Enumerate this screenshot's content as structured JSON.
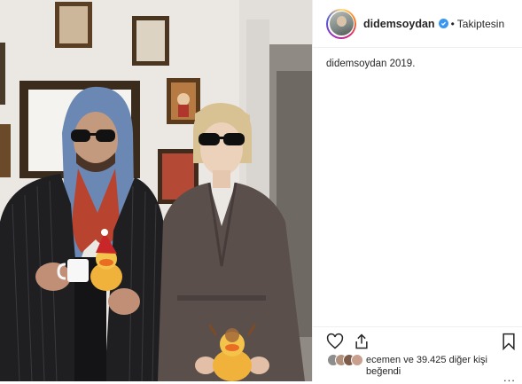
{
  "post": {
    "username": "didemsoydan",
    "separator": "•",
    "follow_status": "Takiptesin",
    "caption_user": "didemsoydan",
    "caption_text": "2019.",
    "likes": {
      "first_liker": "ecemen",
      "joiner": "ve",
      "count_text": "39.425 diğer kişi",
      "verb": "beğendi"
    },
    "more_label": "..."
  },
  "icons": {
    "like": "heart-icon",
    "share": "share-icon",
    "save": "bookmark-icon",
    "verified": "verified-badge-icon",
    "more": "more-options-icon"
  },
  "colors": {
    "verified": "#3897f0",
    "border": "#efefef",
    "text": "#262626"
  }
}
